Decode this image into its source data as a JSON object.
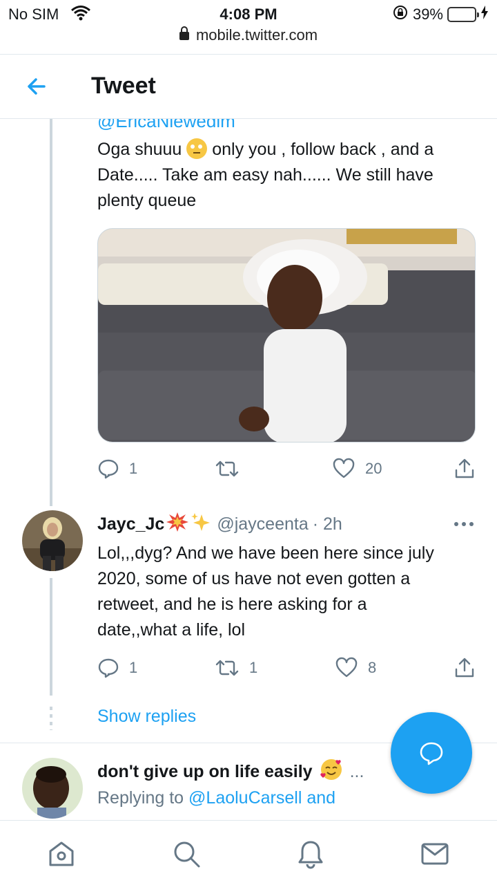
{
  "status_bar": {
    "carrier": "No SIM",
    "time": "4:08 PM",
    "battery": "39%",
    "battery_level": 0.39,
    "url": "mobile.twitter.com"
  },
  "header": {
    "title": "Tweet"
  },
  "tweet1": {
    "handle_partial": "@EricaNlewedim",
    "text_line1a": "Oga shuuu",
    "text_line1b": "only you , follow back , and a",
    "text_line2": "Date..... Take am easy nah...... We still have",
    "text_line3": "plenty queue",
    "emoji": "face-with-rolling-eyes",
    "replies": "1",
    "retweets": "",
    "likes": "20"
  },
  "tweet2": {
    "name": "Jayc_Jc",
    "name_emojis": [
      "collision",
      "sparkles"
    ],
    "handle": "@jayceenta",
    "time": "· 2h",
    "text": [
      "Lol,,,dyg? And we have been here since july",
      "2020, some of us have not even gotten a",
      "retweet, and he is here asking for a",
      "date,,what a life, lol"
    ],
    "replies": "1",
    "retweets": "1",
    "likes": "8"
  },
  "show_replies": "Show replies",
  "tweet3": {
    "name": "don't give up on life easily",
    "emoji": "smiling-face-with-hearts",
    "ellipsis": "...",
    "replying_prefix": "Replying to",
    "replying_link": "@LaoluCarsell and"
  },
  "colors": {
    "accent": "#1da1f2",
    "text": "#14171a",
    "muted": "#657786",
    "border": "#e1e8ed"
  },
  "nav": [
    "home-icon",
    "search-icon",
    "notifications-icon",
    "messages-icon"
  ]
}
